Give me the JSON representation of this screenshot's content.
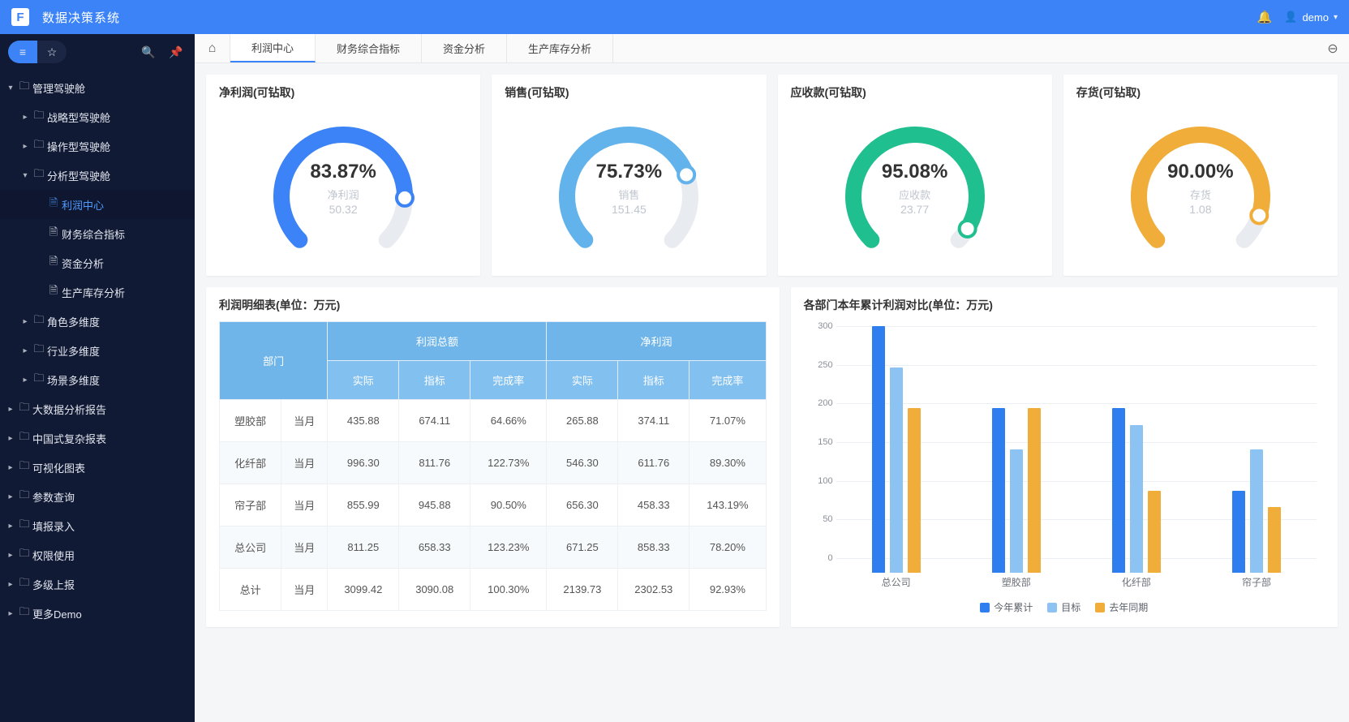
{
  "app": {
    "title": "数据决策系统",
    "user": "demo"
  },
  "sidebar": {
    "items": [
      {
        "lv": 0,
        "icon": "folder",
        "label": "管理驾驶舱",
        "expanded": true
      },
      {
        "lv": 1,
        "icon": "folder",
        "label": "战略型驾驶舱",
        "collapsed": true
      },
      {
        "lv": 1,
        "icon": "folder",
        "label": "操作型驾驶舱",
        "collapsed": true
      },
      {
        "lv": 1,
        "icon": "folder",
        "label": "分析型驾驶舱",
        "expanded": true
      },
      {
        "lv": 2,
        "icon": "file",
        "label": "利润中心",
        "active": true
      },
      {
        "lv": 2,
        "icon": "file",
        "label": "财务综合指标"
      },
      {
        "lv": 2,
        "icon": "file",
        "label": "资金分析"
      },
      {
        "lv": 2,
        "icon": "file",
        "label": "生产库存分析"
      },
      {
        "lv": 1,
        "icon": "folder",
        "label": "角色多维度",
        "collapsed": true
      },
      {
        "lv": 1,
        "icon": "folder",
        "label": "行业多维度",
        "collapsed": true
      },
      {
        "lv": 1,
        "icon": "folder",
        "label": "场景多维度",
        "collapsed": true
      },
      {
        "lv": 0,
        "icon": "folder",
        "label": "大数据分析报告",
        "collapsed": true
      },
      {
        "lv": 0,
        "icon": "folder",
        "label": "中国式复杂报表",
        "collapsed": true
      },
      {
        "lv": 0,
        "icon": "folder",
        "label": "可视化图表",
        "collapsed": true
      },
      {
        "lv": 0,
        "icon": "folder",
        "label": "参数查询",
        "collapsed": true
      },
      {
        "lv": 0,
        "icon": "folder",
        "label": "填报录入",
        "collapsed": true
      },
      {
        "lv": 0,
        "icon": "folder",
        "label": "权限使用",
        "collapsed": true
      },
      {
        "lv": 0,
        "icon": "folder",
        "label": "多级上报",
        "collapsed": true
      },
      {
        "lv": 0,
        "icon": "folder",
        "label": "更多Demo",
        "collapsed": true
      }
    ]
  },
  "tabs": [
    "利润中心",
    "财务综合指标",
    "资金分析",
    "生产库存分析"
  ],
  "activeTab": 0,
  "gauges": [
    {
      "title": "净利润(可钻取)",
      "label": "净利润",
      "percent": 83.87,
      "value": "50.32",
      "color": "#3b83f6"
    },
    {
      "title": "销售(可钻取)",
      "label": "销售",
      "percent": 75.73,
      "value": "151.45",
      "color": "#62b3ec"
    },
    {
      "title": "应收款(可钻取)",
      "label": "应收款",
      "percent": 95.08,
      "value": "23.77",
      "color": "#1fbf8f"
    },
    {
      "title": "存货(可钻取)",
      "label": "存货",
      "percent": 90.0,
      "value": "1.08",
      "color": "#f0ad39"
    }
  ],
  "profitTable": {
    "title": "利润明细表(单位：万元)",
    "head": {
      "dept": "部门",
      "grp1": "利润总额",
      "grp2": "净利润",
      "sub": [
        "实际",
        "指标",
        "完成率",
        "实际",
        "指标",
        "完成率"
      ]
    },
    "rows": [
      {
        "dept": "塑胶部",
        "period": "当月",
        "a": "435.88",
        "b": "674.11",
        "c": "64.66%",
        "ccls": "red",
        "d": "265.88",
        "e": "374.11",
        "f": "71.07%",
        "fcls": "red"
      },
      {
        "dept": "化纤部",
        "period": "当月",
        "a": "996.30",
        "b": "811.76",
        "c": "122.73%",
        "ccls": "green",
        "d": "546.30",
        "e": "611.76",
        "f": "89.30%",
        "fcls": "red"
      },
      {
        "dept": "帘子部",
        "period": "当月",
        "a": "855.99",
        "b": "945.88",
        "c": "90.50%",
        "ccls": "red",
        "d": "656.30",
        "e": "458.33",
        "f": "143.19%",
        "fcls": "green"
      },
      {
        "dept": "总公司",
        "period": "当月",
        "a": "811.25",
        "b": "658.33",
        "c": "123.23%",
        "ccls": "green",
        "d": "671.25",
        "e": "858.33",
        "f": "78.20%",
        "fcls": "red"
      },
      {
        "dept": "总计",
        "period": "当月",
        "a": "3099.42",
        "b": "3090.08",
        "c": "100.30%",
        "ccls": "green",
        "d": "2139.73",
        "e": "2302.53",
        "f": "92.93%",
        "fcls": "red"
      }
    ]
  },
  "barChartTitle": "各部门本年累计利润对比(单位：万元)",
  "chart_data": {
    "type": "bar",
    "title": "各部门本年累计利润对比(单位：万元)",
    "categories": [
      "总公司",
      "塑胶部",
      "化纤部",
      "帘子部"
    ],
    "ylim": [
      0,
      300
    ],
    "yticks": [
      0,
      50,
      100,
      150,
      200,
      250,
      300
    ],
    "series": [
      {
        "name": "今年累计",
        "color": "#2f7ef0",
        "values": [
          300,
          200,
          200,
          100
        ]
      },
      {
        "name": "目标",
        "color": "#8cc3f2",
        "values": [
          250,
          150,
          180,
          150
        ]
      },
      {
        "name": "去年同期",
        "color": "#f0ad39",
        "values": [
          200,
          200,
          100,
          80
        ]
      }
    ]
  },
  "icons": {
    "folder": "🗀",
    "file": "🗎",
    "list": "≡",
    "star": "☆",
    "search": "🔍",
    "pin": "📌",
    "home": "⌂",
    "bell": "🔔",
    "user": "👤",
    "more": "⊖"
  }
}
